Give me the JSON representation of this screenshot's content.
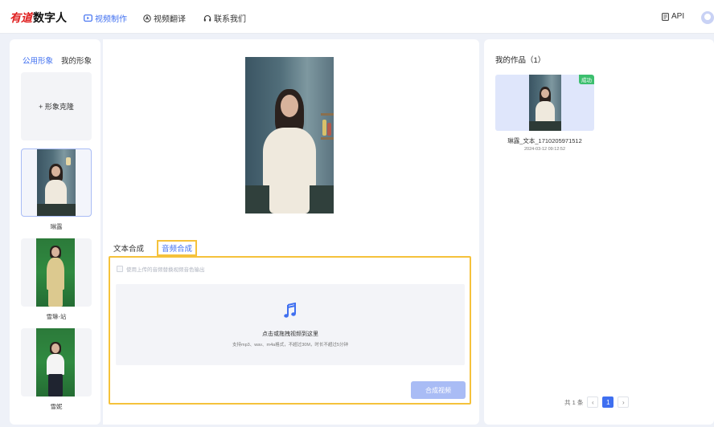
{
  "brand": {
    "part1": "有道",
    "part2": "数字人"
  },
  "nav": [
    {
      "label": "视频制作",
      "active": true,
      "icon": "video-icon"
    },
    {
      "label": "视频翻译",
      "active": false,
      "icon": "translate-icon"
    },
    {
      "label": "联系我们",
      "active": false,
      "icon": "headset-icon"
    }
  ],
  "header_right": {
    "api_label": "API",
    "api_icon": "document-icon",
    "avatar_icon": "user-avatar-icon"
  },
  "left_panel": {
    "tabs": [
      {
        "label": "公用形象",
        "active": true
      },
      {
        "label": "我的形象",
        "active": false
      }
    ],
    "clone_label": "+ 形象克隆",
    "avatars": [
      {
        "name": "琳露",
        "selected": true
      },
      {
        "name": "雪琳-站",
        "selected": false
      },
      {
        "name": "雪妮",
        "selected": false
      }
    ]
  },
  "editor": {
    "tabs": [
      {
        "label": "文本合成",
        "active": false
      },
      {
        "label": "音频合成",
        "active": true
      }
    ],
    "checkbox_label": "使用上传的音频替换视频音色输出",
    "upload_title": "点击或拖拽视频到这里",
    "upload_hint": "支持mp3、wav、m4a格式，不超过30M，时长不超过5分钟",
    "upload_icon": "music-note-icon",
    "submit_label": "合成视频"
  },
  "works": {
    "title": "我的作品（1）",
    "items": [
      {
        "status": "成功",
        "name": "琳露_文本_1710205971512",
        "time": "2024-03-12 09:12:52"
      }
    ]
  },
  "pagination": {
    "total_label": "共 1 条",
    "current": "1",
    "prev_icon": "chevron-left-icon",
    "next_icon": "chevron-right-icon"
  },
  "colors": {
    "accent": "#3f6ff0",
    "highlight": "#f5c23b",
    "success": "#3cbf6e",
    "button_disabled": "#a9bcf5"
  }
}
